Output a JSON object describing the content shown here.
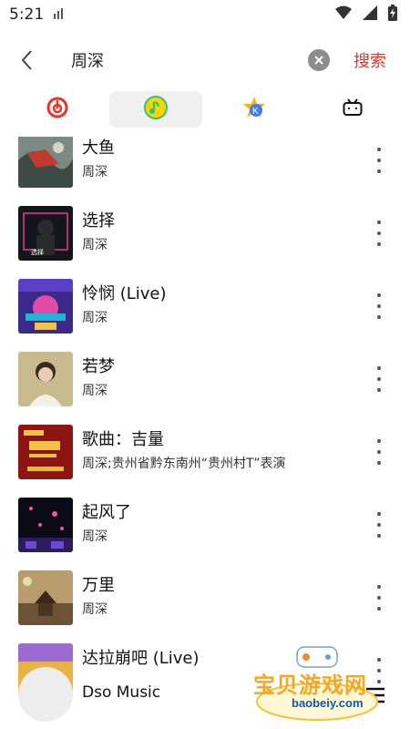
{
  "status": {
    "time": "5:21"
  },
  "search": {
    "query": "周深",
    "button_label": "搜索"
  },
  "tabs": [
    {
      "name": "netease-cloud-music",
      "active": false
    },
    {
      "name": "qq-music",
      "active": true
    },
    {
      "name": "kugou-music",
      "active": false
    },
    {
      "name": "bilibili",
      "active": false
    }
  ],
  "songs": [
    {
      "title": "大鱼",
      "artist": "周深"
    },
    {
      "title": "选择",
      "artist": "周深"
    },
    {
      "title": "怜悯 (Live)",
      "artist": "周深"
    },
    {
      "title": "若梦",
      "artist": "周深"
    },
    {
      "title": "歌曲：吉量",
      "artist": "周深;贵州省黔东南州“贵州村T”表演"
    },
    {
      "title": "起风了",
      "artist": "周深"
    },
    {
      "title": "万里",
      "artist": "周深"
    },
    {
      "title": "达拉崩吧 (Live)",
      "artist": ""
    }
  ],
  "player": {
    "title": "Dso Music"
  },
  "watermark": {
    "text": "宝贝游戏网",
    "url": "baobeiy.com"
  },
  "colors": {
    "accent": "#e5352d",
    "qq_green": "#31c27c",
    "qq_yellow": "#ffd400"
  }
}
